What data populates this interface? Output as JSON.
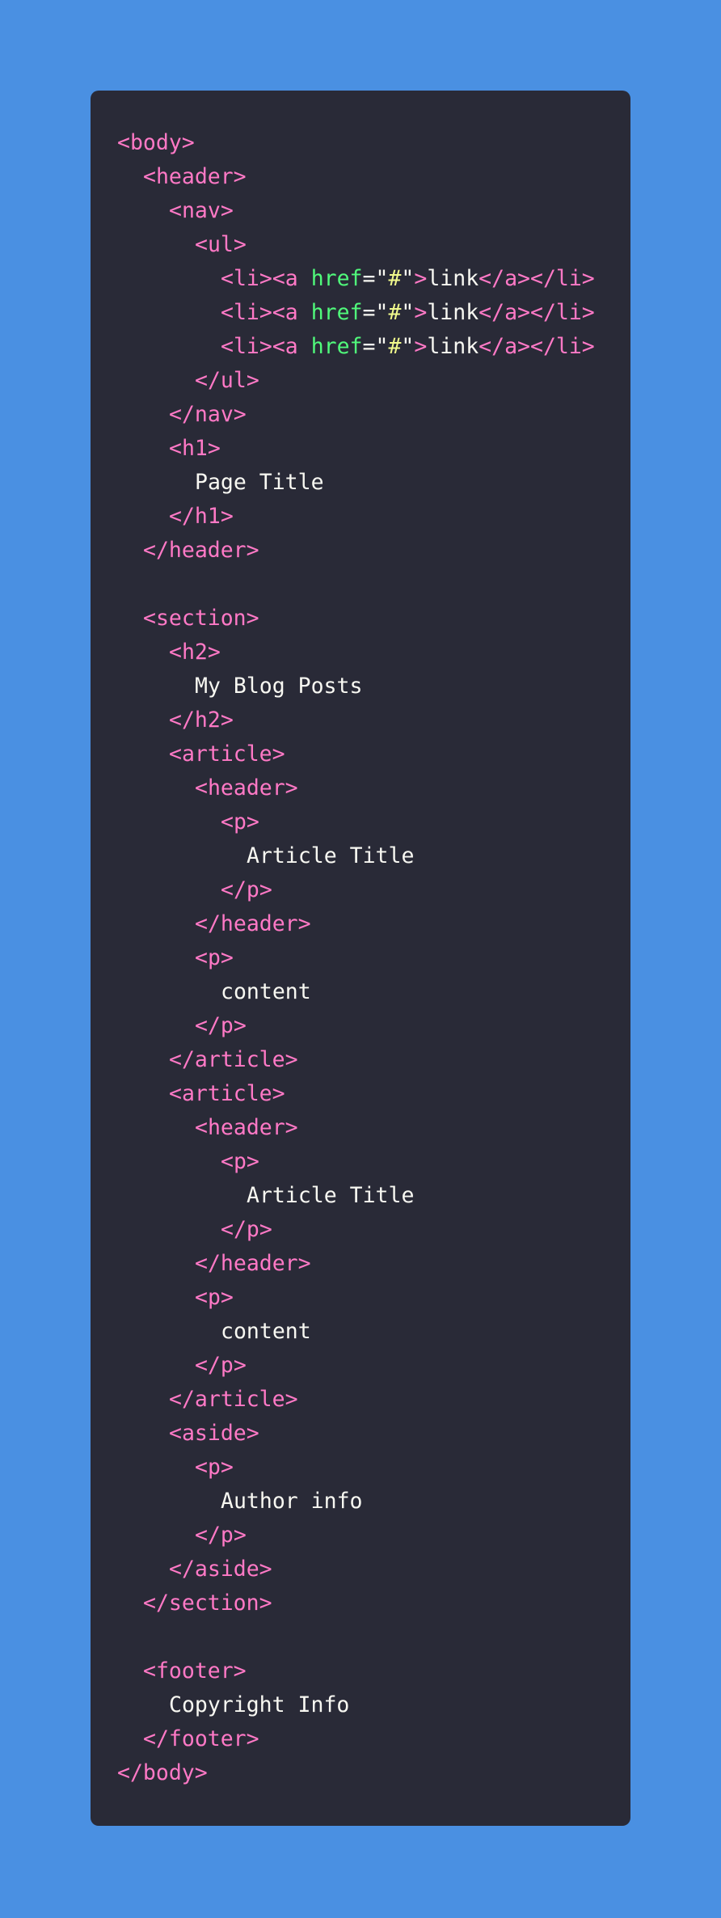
{
  "colors": {
    "background": "#4A90E2",
    "panel": "#292A37",
    "tag": "#FF79C6",
    "attribute": "#50FA7B",
    "string": "#F1FA8C",
    "text": "#F8F8F2"
  },
  "code": {
    "lines": [
      {
        "indent": 0,
        "tokens": [
          {
            "t": "tag",
            "v": "<body>"
          }
        ]
      },
      {
        "indent": 1,
        "tokens": [
          {
            "t": "tag",
            "v": "<header>"
          }
        ]
      },
      {
        "indent": 2,
        "tokens": [
          {
            "t": "tag",
            "v": "<nav>"
          }
        ]
      },
      {
        "indent": 3,
        "tokens": [
          {
            "t": "tag",
            "v": "<ul>"
          }
        ]
      },
      {
        "indent": 4,
        "tokens": [
          {
            "t": "tag",
            "v": "<li><a "
          },
          {
            "t": "attr",
            "v": "href"
          },
          {
            "t": "punct",
            "v": "=\""
          },
          {
            "t": "str",
            "v": "#"
          },
          {
            "t": "punct",
            "v": "\""
          },
          {
            "t": "tag",
            "v": ">"
          },
          {
            "t": "text",
            "v": "link"
          },
          {
            "t": "tag",
            "v": "</a></li>"
          }
        ]
      },
      {
        "indent": 4,
        "tokens": [
          {
            "t": "tag",
            "v": "<li><a "
          },
          {
            "t": "attr",
            "v": "href"
          },
          {
            "t": "punct",
            "v": "=\""
          },
          {
            "t": "str",
            "v": "#"
          },
          {
            "t": "punct",
            "v": "\""
          },
          {
            "t": "tag",
            "v": ">"
          },
          {
            "t": "text",
            "v": "link"
          },
          {
            "t": "tag",
            "v": "</a></li>"
          }
        ]
      },
      {
        "indent": 4,
        "tokens": [
          {
            "t": "tag",
            "v": "<li><a "
          },
          {
            "t": "attr",
            "v": "href"
          },
          {
            "t": "punct",
            "v": "=\""
          },
          {
            "t": "str",
            "v": "#"
          },
          {
            "t": "punct",
            "v": "\""
          },
          {
            "t": "tag",
            "v": ">"
          },
          {
            "t": "text",
            "v": "link"
          },
          {
            "t": "tag",
            "v": "</a></li>"
          }
        ]
      },
      {
        "indent": 3,
        "tokens": [
          {
            "t": "tag",
            "v": "</ul>"
          }
        ]
      },
      {
        "indent": 2,
        "tokens": [
          {
            "t": "tag",
            "v": "</nav>"
          }
        ]
      },
      {
        "indent": 2,
        "tokens": [
          {
            "t": "tag",
            "v": "<h1>"
          }
        ]
      },
      {
        "indent": 3,
        "tokens": [
          {
            "t": "text",
            "v": "Page Title"
          }
        ]
      },
      {
        "indent": 2,
        "tokens": [
          {
            "t": "tag",
            "v": "</h1>"
          }
        ]
      },
      {
        "indent": 1,
        "tokens": [
          {
            "t": "tag",
            "v": "</header>"
          }
        ]
      },
      {
        "indent": 0,
        "tokens": []
      },
      {
        "indent": 1,
        "tokens": [
          {
            "t": "tag",
            "v": "<section>"
          }
        ]
      },
      {
        "indent": 2,
        "tokens": [
          {
            "t": "tag",
            "v": "<h2>"
          }
        ]
      },
      {
        "indent": 3,
        "tokens": [
          {
            "t": "text",
            "v": "My Blog Posts"
          }
        ]
      },
      {
        "indent": 2,
        "tokens": [
          {
            "t": "tag",
            "v": "</h2>"
          }
        ]
      },
      {
        "indent": 2,
        "tokens": [
          {
            "t": "tag",
            "v": "<article>"
          }
        ]
      },
      {
        "indent": 3,
        "tokens": [
          {
            "t": "tag",
            "v": "<header>"
          }
        ]
      },
      {
        "indent": 4,
        "tokens": [
          {
            "t": "tag",
            "v": "<p>"
          }
        ]
      },
      {
        "indent": 5,
        "tokens": [
          {
            "t": "text",
            "v": "Article Title"
          }
        ]
      },
      {
        "indent": 4,
        "tokens": [
          {
            "t": "tag",
            "v": "</p>"
          }
        ]
      },
      {
        "indent": 3,
        "tokens": [
          {
            "t": "tag",
            "v": "</header>"
          }
        ]
      },
      {
        "indent": 3,
        "tokens": [
          {
            "t": "tag",
            "v": "<p>"
          }
        ]
      },
      {
        "indent": 4,
        "tokens": [
          {
            "t": "text",
            "v": "content"
          }
        ]
      },
      {
        "indent": 3,
        "tokens": [
          {
            "t": "tag",
            "v": "</p>"
          }
        ]
      },
      {
        "indent": 2,
        "tokens": [
          {
            "t": "tag",
            "v": "</article>"
          }
        ]
      },
      {
        "indent": 2,
        "tokens": [
          {
            "t": "tag",
            "v": "<article>"
          }
        ]
      },
      {
        "indent": 3,
        "tokens": [
          {
            "t": "tag",
            "v": "<header>"
          }
        ]
      },
      {
        "indent": 4,
        "tokens": [
          {
            "t": "tag",
            "v": "<p>"
          }
        ]
      },
      {
        "indent": 5,
        "tokens": [
          {
            "t": "text",
            "v": "Article Title"
          }
        ]
      },
      {
        "indent": 4,
        "tokens": [
          {
            "t": "tag",
            "v": "</p>"
          }
        ]
      },
      {
        "indent": 3,
        "tokens": [
          {
            "t": "tag",
            "v": "</header>"
          }
        ]
      },
      {
        "indent": 3,
        "tokens": [
          {
            "t": "tag",
            "v": "<p>"
          }
        ]
      },
      {
        "indent": 4,
        "tokens": [
          {
            "t": "text",
            "v": "content"
          }
        ]
      },
      {
        "indent": 3,
        "tokens": [
          {
            "t": "tag",
            "v": "</p>"
          }
        ]
      },
      {
        "indent": 2,
        "tokens": [
          {
            "t": "tag",
            "v": "</article>"
          }
        ]
      },
      {
        "indent": 2,
        "tokens": [
          {
            "t": "tag",
            "v": "<aside>"
          }
        ]
      },
      {
        "indent": 3,
        "tokens": [
          {
            "t": "tag",
            "v": "<p>"
          }
        ]
      },
      {
        "indent": 4,
        "tokens": [
          {
            "t": "text",
            "v": "Author info"
          }
        ]
      },
      {
        "indent": 3,
        "tokens": [
          {
            "t": "tag",
            "v": "</p>"
          }
        ]
      },
      {
        "indent": 2,
        "tokens": [
          {
            "t": "tag",
            "v": "</aside>"
          }
        ]
      },
      {
        "indent": 1,
        "tokens": [
          {
            "t": "tag",
            "v": "</section>"
          }
        ]
      },
      {
        "indent": 0,
        "tokens": []
      },
      {
        "indent": 1,
        "tokens": [
          {
            "t": "tag",
            "v": "<footer>"
          }
        ]
      },
      {
        "indent": 2,
        "tokens": [
          {
            "t": "text",
            "v": "Copyright Info"
          }
        ]
      },
      {
        "indent": 1,
        "tokens": [
          {
            "t": "tag",
            "v": "</footer>"
          }
        ]
      },
      {
        "indent": 0,
        "tokens": [
          {
            "t": "tag",
            "v": "</body>"
          }
        ]
      }
    ]
  }
}
